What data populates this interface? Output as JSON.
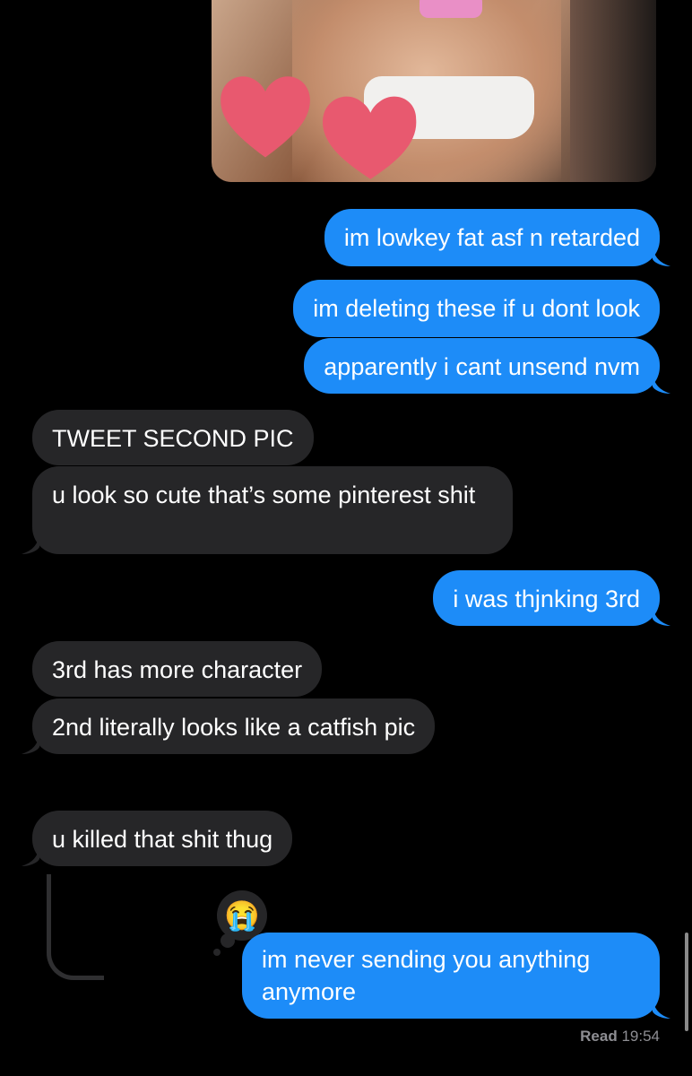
{
  "image_attachment": {
    "description_icon": "photo-attachment"
  },
  "messages": [
    {
      "id": "m1",
      "direction": "sent",
      "text": "im lowkey fat asf n retarded"
    },
    {
      "id": "m2",
      "direction": "sent",
      "text": "im deleting these if u dont look"
    },
    {
      "id": "m3",
      "direction": "sent",
      "text": "apparently i cant unsend nvm"
    },
    {
      "id": "m4",
      "direction": "received",
      "text": "TWEET SECOND PIC"
    },
    {
      "id": "m5",
      "direction": "received",
      "text": "u look so cute that’s some pinterest shit"
    },
    {
      "id": "m6",
      "direction": "sent",
      "text": "i was thjnking 3rd"
    },
    {
      "id": "m7",
      "direction": "received",
      "text": "3rd has more character"
    },
    {
      "id": "m8",
      "direction": "received",
      "text": "2nd literally looks like a catfish pic"
    },
    {
      "id": "m9",
      "direction": "received",
      "text": "u killed that shit thug"
    },
    {
      "id": "m10",
      "direction": "sent",
      "text": "im never sending you anything anymore"
    }
  ],
  "tapback": {
    "emoji": "😭"
  },
  "read_receipt": {
    "label": "Read",
    "time": "19:54"
  },
  "colors": {
    "sent_bubble": "#1d8cf8",
    "received_bubble": "#262628",
    "background": "#000000",
    "heart": "#e8596f"
  }
}
